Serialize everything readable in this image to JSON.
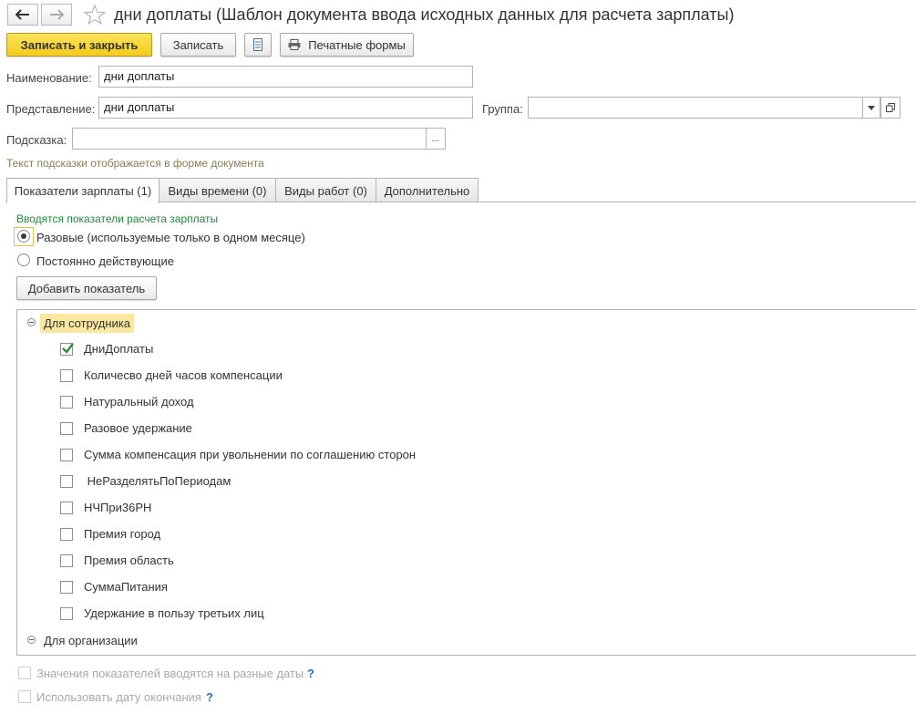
{
  "window": {
    "title": "дни доплаты (Шаблон документа ввода исходных данных для расчета зарплаты)"
  },
  "toolbar": {
    "save_close_label": "Записать и закрыть",
    "save_label": "Записать",
    "print_label": "Печатные формы"
  },
  "form": {
    "name_label": "Наименование:",
    "name_value": "дни доплаты",
    "repr_label": "Представление:",
    "repr_value": "дни доплаты",
    "group_label": "Группа:",
    "group_value": "",
    "hint_label": "Подсказка:",
    "hint_value": "",
    "hint_btn": "...",
    "hint_note": "Текст подсказки отображается в форме документа"
  },
  "tabs": [
    {
      "label": "Показатели зарплаты (1)",
      "active": true
    },
    {
      "label": "Виды времени (0)"
    },
    {
      "label": "Виды работ (0)"
    },
    {
      "label": "Дополнительно"
    }
  ],
  "indicators": {
    "section_title": "Вводятся показатели расчета зарплаты",
    "radio_once": "Разовые (используемые только в одном месяце)",
    "radio_permanent": "Постоянно действующие",
    "selected": "once",
    "add_button": "Добавить показатель"
  },
  "tree": {
    "employee_group": "Для сотрудника",
    "items": [
      {
        "label": "ДниДоплаты",
        "checked": true
      },
      {
        "label": "Количесво дней часов компенсации",
        "checked": false
      },
      {
        "label": "Натуральный доход",
        "checked": false
      },
      {
        "label": "Разовое удержание",
        "checked": false
      },
      {
        "label": "Сумма компенсация при увольнении по соглашению сторон",
        "checked": false
      },
      {
        "label": " НеРазделятьПоПериодам",
        "checked": false
      },
      {
        "label": "НЧПри36РН",
        "checked": false
      },
      {
        "label": "Премия город",
        "checked": false
      },
      {
        "label": "Премия область",
        "checked": false
      },
      {
        "label": "СуммаПитания",
        "checked": false
      },
      {
        "label": "Удержание в пользу третьих лиц",
        "checked": false
      }
    ],
    "org_group": "Для организации"
  },
  "options": {
    "different_dates": "Значения показателей вводятся на разные даты",
    "use_end_date": "Использовать дату окончания",
    "help_mark": "?"
  },
  "colors": {
    "primary_button": "#f3cc1b",
    "section_title": "#1f8a3b",
    "highlight": "#fbe8a0",
    "check": "#2e8b3a",
    "help": "#2a6fbf"
  }
}
